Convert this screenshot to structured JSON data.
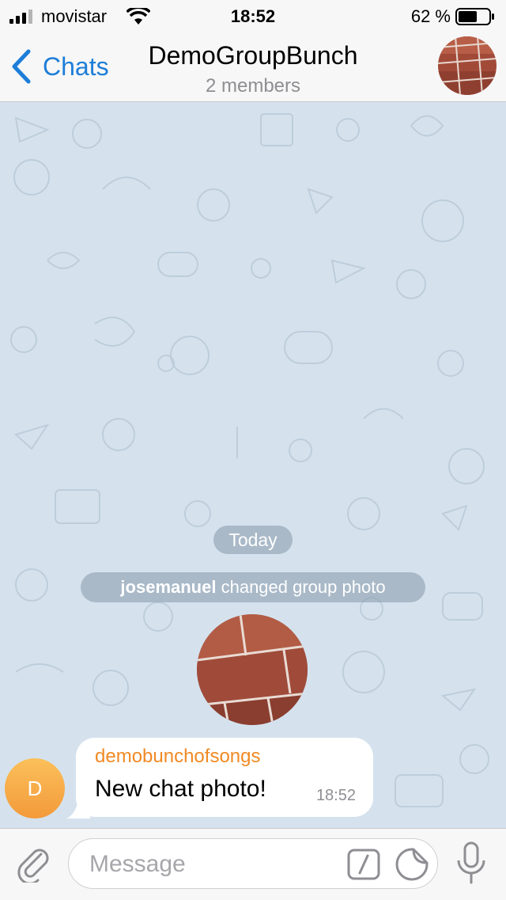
{
  "status_bar": {
    "carrier": "movistar",
    "time": "18:52",
    "battery_percent": "62 %",
    "battery_level": 0.62
  },
  "nav": {
    "back_label": "Chats",
    "title": "DemoGroupBunch",
    "subtitle": "2 members"
  },
  "chat": {
    "date_separator": "Today",
    "service_message": {
      "actor": "josemanuel",
      "action": "changed group photo"
    },
    "messages": [
      {
        "sender": "demobunchofsongs",
        "avatar_initial": "D",
        "text": "New chat photo!",
        "time": "18:52"
      }
    ]
  },
  "input": {
    "placeholder": "Message",
    "value": ""
  },
  "icons": {
    "signal": "signal-icon",
    "wifi": "wifi-icon",
    "battery": "battery-icon",
    "back": "chevron-left-icon",
    "attach": "paperclip-icon",
    "commands": "slash-command-icon",
    "sticker": "sticker-icon",
    "mic": "microphone-icon"
  },
  "colors": {
    "accent": "#1d7ed8",
    "chat_background": "#d5e2ee",
    "sender_name": "#f08a24",
    "avatar_gradient_top": "#fbc05a",
    "avatar_gradient_bottom": "#f39a3a"
  }
}
